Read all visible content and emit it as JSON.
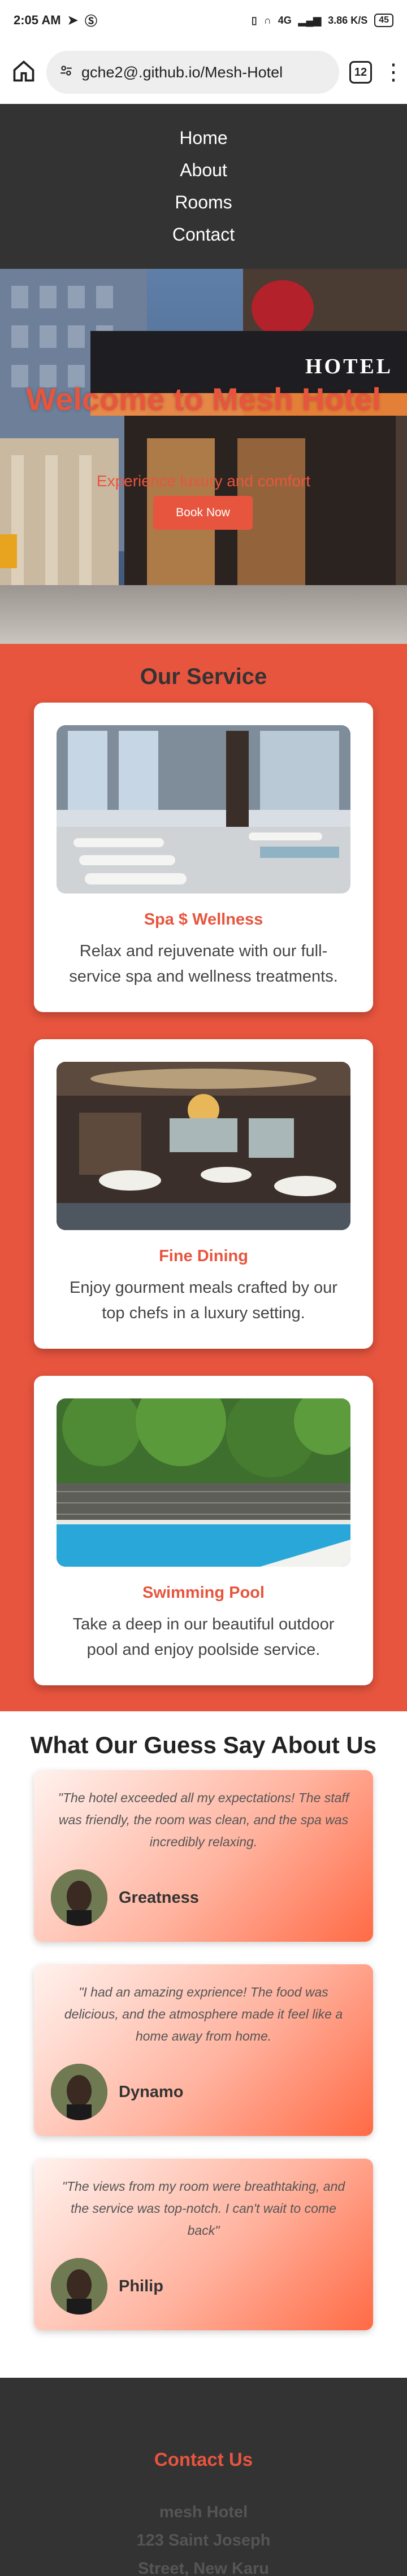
{
  "status_bar": {
    "time": "2:05 AM",
    "network": "4G",
    "speed": "3.86 K/S",
    "battery": "45"
  },
  "browser": {
    "url": "gche2@.github.io/Mesh-Hotel",
    "tab_count": "12"
  },
  "nav": {
    "items": [
      "Home",
      "About",
      "Rooms",
      "Contact"
    ]
  },
  "hero": {
    "sign": "HOTEL",
    "title": "Welcome to Mesh Hotel",
    "subtitle": "Experience luxury and comfort",
    "button": "Book Now"
  },
  "services": {
    "title": "Our Service",
    "items": [
      {
        "title": "Spa $ Wellness",
        "text": "Relax and rejuvenate with our full-service spa and wellness treatments."
      },
      {
        "title": "Fine Dining",
        "text": "Enjoy gourment meals crafted by our top chefs in a luxury setting."
      },
      {
        "title": "Swimming Pool",
        "text": "Take a deep in our beautiful outdoor pool and enjoy poolside service."
      }
    ]
  },
  "testimonials": {
    "title": "What Our Guess Say About Us",
    "items": [
      {
        "quote": "\"The hotel exceeded all my expectations! The staff was friendly, the room was clean, and the spa was incredibly relaxing.",
        "name": "Greatness"
      },
      {
        "quote": "\"I had an amazing exprience! The food was delicious, and the atmosphere made it feel like a home away from home.",
        "name": "Dynamo"
      },
      {
        "quote": "\"The views from my room were breathtaking, and the service was top-notch. I can't wait to come back\"",
        "name": "Philip"
      }
    ]
  },
  "footer": {
    "title": "Contact Us",
    "line1": "mesh Hotel",
    "line2": "123 Saint Joseph",
    "line3": "Street, New Karu"
  },
  "colors": {
    "accent": "#e8553e",
    "dark": "#333333"
  }
}
